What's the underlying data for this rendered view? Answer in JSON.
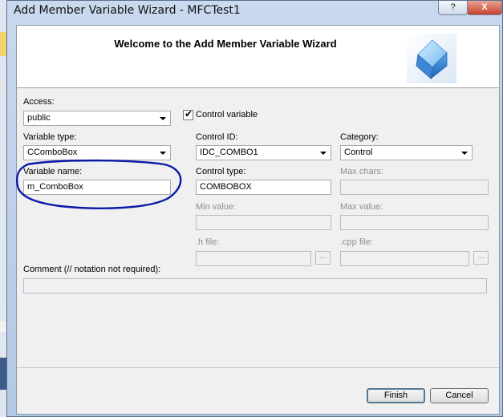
{
  "window": {
    "title": "Add Member Variable Wizard - MFCTest1",
    "help_label": "?",
    "close_label": "X"
  },
  "header": {
    "title": "Welcome to the Add Member Variable Wizard"
  },
  "form": {
    "access": {
      "label": "Access:",
      "value": "public"
    },
    "control_variable": {
      "label": "Control variable",
      "checked": true
    },
    "variable_type": {
      "label": "Variable type:",
      "value": "CComboBox"
    },
    "control_id": {
      "label": "Control ID:",
      "value": "IDC_COMBO1"
    },
    "category": {
      "label": "Category:",
      "value": "Control"
    },
    "variable_name": {
      "label": "Variable name:",
      "value": "m_ComboBox"
    },
    "control_type": {
      "label": "Control type:",
      "value": "COMBOBOX"
    },
    "max_chars": {
      "label": "Max chars:",
      "value": ""
    },
    "min_value": {
      "label": "Min value:",
      "value": ""
    },
    "max_value": {
      "label": "Max value:",
      "value": ""
    },
    "h_file": {
      "label": ".h file:",
      "value": "",
      "browse": "..."
    },
    "cpp_file": {
      "label": ".cpp file:",
      "value": "",
      "browse": "..."
    },
    "comment": {
      "label": "Comment (// notation not required):",
      "value": ""
    }
  },
  "buttons": {
    "finish": "Finish",
    "cancel": "Cancel"
  },
  "colors": {
    "annotation_ink": "#0a1aa8",
    "window_frame": "#b3c8e4",
    "dialog_bg": "#f0f0f0"
  }
}
